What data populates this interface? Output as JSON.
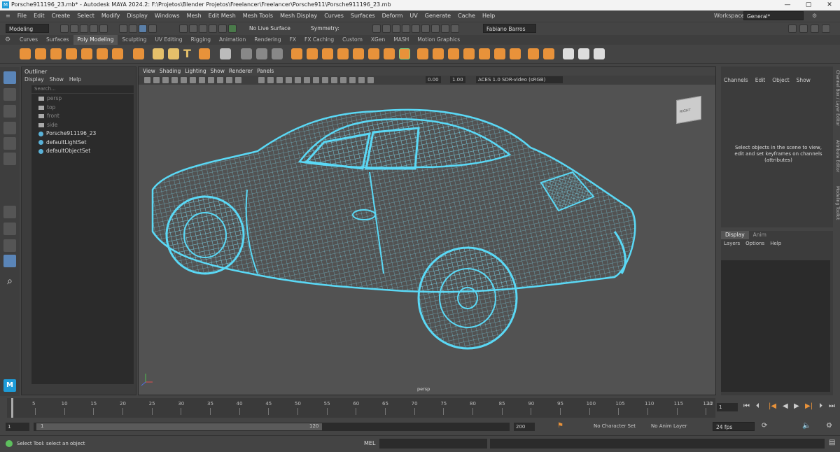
{
  "titlebar": {
    "title": "Porsche911196_23.mb* - Autodesk MAYA 2024.2: F:\\Projetos\\Blender Projetos\\Freelancer\\Freelancer\\Porsche911\\Porsche911196_23.mb",
    "minimize": "—",
    "maximize": "▢",
    "close": "✕"
  },
  "menubar": {
    "items": [
      "File",
      "Edit",
      "Create",
      "Select",
      "Modify",
      "Display",
      "Windows",
      "Mesh",
      "Edit Mesh",
      "Mesh Tools",
      "Mesh Display",
      "Curves",
      "Surfaces",
      "Deform",
      "UV",
      "Generate",
      "Cache",
      "Help"
    ],
    "workspace_label": "Workspace:",
    "workspace_value": "General*"
  },
  "statusline": {
    "menuset": "Modeling",
    "live_surface": "No Live Surface",
    "symmetry": "Symmetry: Off",
    "user": "Fabiano Barros"
  },
  "shelf": {
    "tabs": [
      "Curves",
      "Surfaces",
      "Poly Modeling",
      "Sculpting",
      "UV Editing",
      "Rigging",
      "Animation",
      "Rendering",
      "FX",
      "FX Caching",
      "Custom",
      "XGen",
      "MASH",
      "Motion Graphics"
    ],
    "active_tab": "Poly Modeling"
  },
  "outliner": {
    "title": "Outliner",
    "menu": [
      "Display",
      "Show",
      "Help"
    ],
    "search_placeholder": "Search...",
    "items": [
      {
        "label": "persp",
        "kind": "cam"
      },
      {
        "label": "top",
        "kind": "cam"
      },
      {
        "label": "front",
        "kind": "cam"
      },
      {
        "label": "side",
        "kind": "cam"
      },
      {
        "label": "Porsche911196_23",
        "kind": "obj"
      },
      {
        "label": "defaultLightSet",
        "kind": "obj"
      },
      {
        "label": "defaultObjectSet",
        "kind": "obj"
      }
    ]
  },
  "viewport": {
    "menu": [
      "View",
      "Shading",
      "Lighting",
      "Show",
      "Renderer",
      "Panels"
    ],
    "exposure": "0.00",
    "gamma": "1.00",
    "colorspace": "ACES 1.0 SDR-video (sRGB)",
    "camera_label": "persp",
    "viewcube_label": "RIGHT"
  },
  "channelbox": {
    "menu": [
      "Channels",
      "Edit",
      "Object",
      "Show"
    ],
    "message": "Select objects in the scene to view, edit and set keyframes on channels (attributes)"
  },
  "layereditor": {
    "tabs": [
      "Display",
      "Anim"
    ],
    "menu": [
      "Layers",
      "Options",
      "Help"
    ]
  },
  "sidetabs": [
    "Channel Box / Layer Editor",
    "Attribute Editor",
    "Modeling Toolkit"
  ],
  "timeslider": {
    "ticks": [
      "5",
      "10",
      "15",
      "20",
      "25",
      "30",
      "35",
      "40",
      "45",
      "50",
      "55",
      "60",
      "65",
      "70",
      "75",
      "80",
      "85",
      "90",
      "95",
      "100",
      "105",
      "110",
      "115",
      "120"
    ],
    "current_frame": "1",
    "end_label": "12"
  },
  "rangeslider": {
    "start": "1",
    "inner_start": "1",
    "inner_end": "120",
    "end": "200",
    "character_set": "No Character Set",
    "anim_layer": "No Anim Layer",
    "fps": "24 fps"
  },
  "cmdline": {
    "help": "Select Tool: select an object",
    "mel": "MEL"
  },
  "colors": {
    "wire": "#5ad8f5",
    "shelf_orange": "#e8923a"
  }
}
